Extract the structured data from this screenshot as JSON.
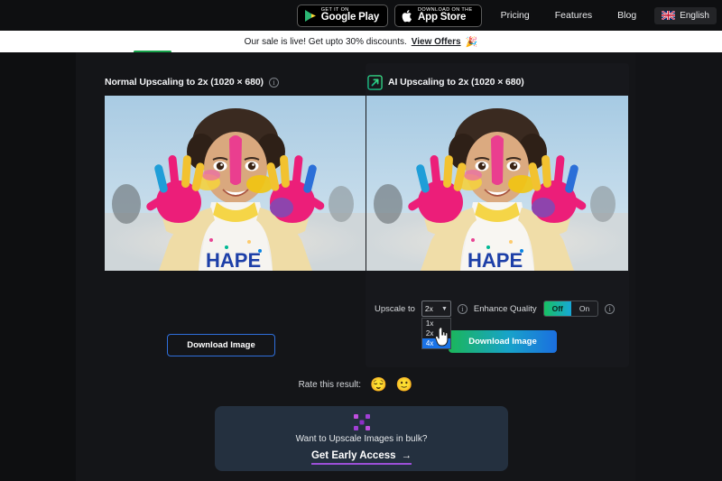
{
  "topnav": {
    "google_play": {
      "small": "GET IT ON",
      "big": "Google Play"
    },
    "app_store": {
      "small": "Download on the",
      "big": "App Store"
    },
    "links": [
      "Pricing",
      "Features",
      "Blog"
    ],
    "language": "English"
  },
  "promo": {
    "text": "Our sale is live! Get upto 30% discounts.",
    "link": "View Offers",
    "emoji": "🎉"
  },
  "panels": {
    "left": {
      "title": "Normal Upscaling to 2x (1020 × 680)",
      "download_label": "Download Image"
    },
    "right": {
      "title": "AI Upscaling to 2x (1020 × 680)",
      "download_label": "Download Image",
      "upscale_label": "Upscale to",
      "upscale_value": "2x",
      "upscale_options": [
        "1x",
        "2x",
        "4x"
      ],
      "upscale_highlighted": "4x",
      "enhance_label": "Enhance Quality",
      "enhance_off": "Off",
      "enhance_on": "On"
    }
  },
  "rate": {
    "label": "Rate this result:",
    "emoji_sad": "😌",
    "emoji_neutral": "🙂"
  },
  "bulk": {
    "question": "Want to Upscale Images in bulk?",
    "cta": "Get Early Access",
    "arrow": "→"
  },
  "colors": {
    "accent_green": "#17a34a",
    "accent_blue": "#2f6fdc",
    "highlight_blue": "#1a73e8",
    "purple": "#9b4fd6",
    "card_bg": "#24303f"
  }
}
